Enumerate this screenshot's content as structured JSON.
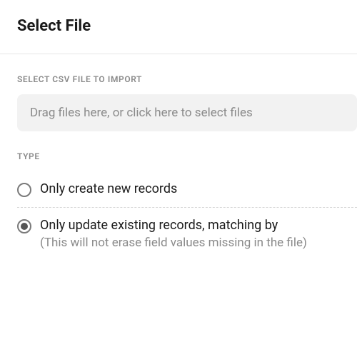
{
  "title": "Select File",
  "file_section": {
    "label": "SELECT CSV FILE TO IMPORT",
    "dropzone_text": "Drag files here, or click here to select files"
  },
  "type_section": {
    "label": "TYPE",
    "options": [
      {
        "label": "Only create new records",
        "subtext": "",
        "selected": false
      },
      {
        "label": "Only update existing records, matching by",
        "subtext": "(This will not erase field values missing in the file)",
        "selected": true
      }
    ]
  }
}
